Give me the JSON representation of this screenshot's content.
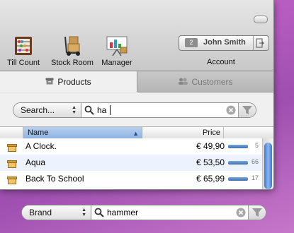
{
  "toolbar": {
    "items": [
      {
        "label": "Till Count",
        "icon": "abacus-icon"
      },
      {
        "label": "Stock Room",
        "icon": "hand-truck-icon"
      },
      {
        "label": "Manager",
        "icon": "presentation-board-icon"
      }
    ],
    "account": {
      "badge": "2",
      "name": "John Smith",
      "label": "Account"
    }
  },
  "tabs": [
    {
      "label": "Products",
      "active": true,
      "icon": "box-icon"
    },
    {
      "label": "Customers",
      "active": false,
      "icon": "people-icon"
    }
  ],
  "search": {
    "scope": "Search...",
    "query": "ha"
  },
  "table": {
    "columns": [
      "Name",
      "Price"
    ],
    "rows": [
      {
        "name": "A Clock.",
        "price": "€ 49,90",
        "count": "5"
      },
      {
        "name": "Aqua",
        "price": "€ 53,50",
        "count": "66"
      },
      {
        "name": "Back To School",
        "price": "€ 65,99",
        "count": "17"
      }
    ]
  },
  "bottom_search": {
    "scope": "Brand",
    "query": "hammer"
  },
  "colors": {
    "accent": "#8fb3e0",
    "row_alt": "#edf3fe",
    "desktop": "#b65bbf"
  }
}
